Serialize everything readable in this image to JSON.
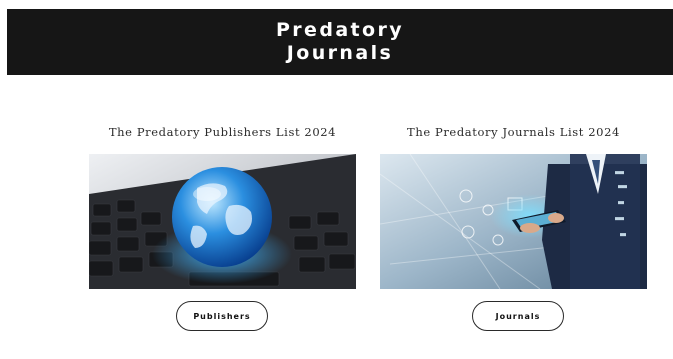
{
  "header": {
    "title": "Predatory\nJournals"
  },
  "cards": [
    {
      "title": "The Predatory Publishers List 2024",
      "image_icon": "globe-on-keyboard-image",
      "button_label": "Publishers"
    },
    {
      "title": "The Predatory Journals List 2024",
      "image_icon": "businessman-tablet-data-image",
      "button_label": "Journals"
    }
  ],
  "colors": {
    "header_bg": "#161616",
    "header_text": "#ffffff",
    "page_bg": "#ffffff"
  }
}
